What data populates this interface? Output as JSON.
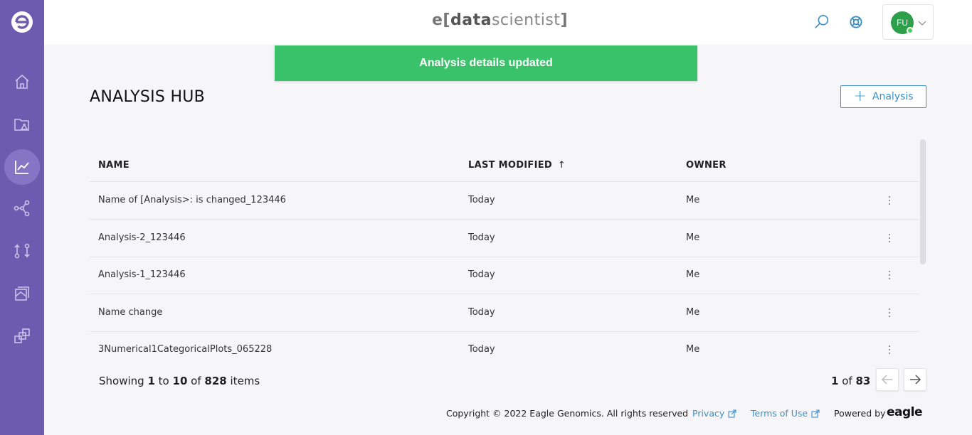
{
  "brand": {
    "e": "e",
    "open_bracket": "[",
    "data": "data",
    "scientist": "scientist",
    "close_bracket": "]"
  },
  "user": {
    "initials": "FU"
  },
  "toast": {
    "message": "Analysis details updated",
    "color": "#3ac26b"
  },
  "page": {
    "title": "ANALYSIS HUB"
  },
  "toolbar": {
    "add_label": "Analysis"
  },
  "table": {
    "columns": [
      "NAME",
      "LAST MODIFIED",
      "OWNER"
    ],
    "sort_indicator": "↑",
    "rows": [
      {
        "name": "Name of [Analysis>: is changed_123446",
        "modified": "Today",
        "owner": "Me"
      },
      {
        "name": "Analysis-2_123446",
        "modified": "Today",
        "owner": "Me"
      },
      {
        "name": "Analysis-1_123446",
        "modified": "Today",
        "owner": "Me"
      },
      {
        "name": "Name change",
        "modified": "Today",
        "owner": "Me"
      },
      {
        "name": "3Numerical1CategoricalPlots_065228",
        "modified": "Today",
        "owner": "Me"
      }
    ]
  },
  "pagination": {
    "showing_prefix": "Showing",
    "from": "1",
    "to_word": "to",
    "to": "10",
    "of_word": "of",
    "total": "828",
    "items_word": "items",
    "current_page": "1",
    "page_of_word": "of",
    "page_count": "83"
  },
  "footer": {
    "copyright": "Copyright © 2022 Eagle Genomics. All rights reserved",
    "privacy": "Privacy",
    "terms": "Terms of Use",
    "powered_by": "Powered by",
    "logo_text": "eagle"
  },
  "colors": {
    "sidebar": "#6b5cb0",
    "sidebar_active": "#8576c5",
    "accent": "#3d8fc4",
    "avatar": "#2d9f4a"
  },
  "icons": {
    "sidebar": [
      "home-icon",
      "folder-flask-icon",
      "analysis-chart-icon",
      "workflow-nodes-icon",
      "transfer-icon",
      "layers-icon",
      "copy-blocks-icon"
    ],
    "topbar": [
      "search-icon",
      "support-lifebuoy-icon",
      "chevron-down-icon"
    ]
  }
}
